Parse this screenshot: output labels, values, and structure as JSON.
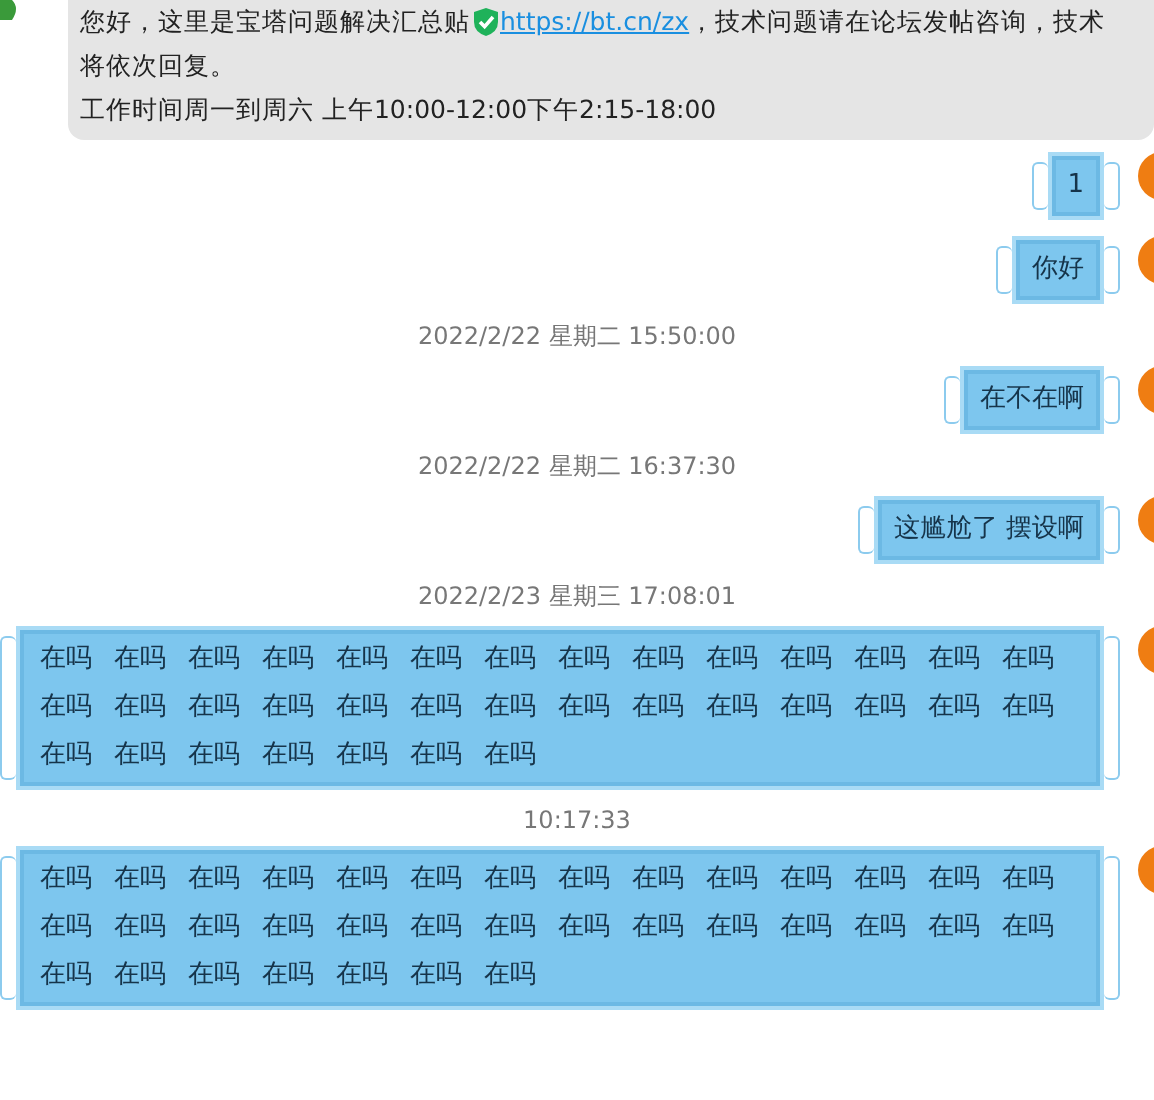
{
  "messages": [
    {
      "kind": "notice",
      "lines": [
        "您好，这里是宝塔问题解决汇总贴",
        "，技术问题请在论坛发帖咨询，技术",
        "将依次回复。",
        "工作时间周一到周六 上午10:00-12:00下午2:15-18:00"
      ],
      "link": "https://bt.cn/zx"
    },
    {
      "kind": "bubble",
      "text": "1"
    },
    {
      "kind": "bubble",
      "text": "你好"
    },
    {
      "kind": "time",
      "text": "2022/2/22 星期二 15:50:00"
    },
    {
      "kind": "bubble",
      "text": "在不在啊"
    },
    {
      "kind": "time",
      "text": "2022/2/22 星期二 16:37:30"
    },
    {
      "kind": "bubble",
      "text": "这尴尬了 摆设啊"
    },
    {
      "kind": "time",
      "text": "2022/2/23 星期三 17:08:01"
    },
    {
      "kind": "repeated",
      "words": [
        "在吗",
        "在吗",
        "在吗",
        "在吗",
        "在吗",
        "在吗",
        "在吗",
        "在吗",
        "在吗",
        "在吗",
        "在吗",
        "在吗",
        "在吗",
        "在吗",
        "在吗",
        "在吗",
        "在吗",
        "在吗",
        "在吗",
        "在吗",
        "在吗",
        "在吗",
        "在吗",
        "在吗",
        "在吗",
        "在吗",
        "在吗",
        "在吗",
        "在吗",
        "在吗",
        "在吗",
        "在吗",
        "在吗",
        "在吗",
        "在吗"
      ]
    },
    {
      "kind": "time",
      "text": "10:17:33"
    },
    {
      "kind": "repeated",
      "words": [
        "在吗",
        "在吗",
        "在吗",
        "在吗",
        "在吗",
        "在吗",
        "在吗",
        "在吗",
        "在吗",
        "在吗",
        "在吗",
        "在吗",
        "在吗",
        "在吗",
        "在吗",
        "在吗",
        "在吗",
        "在吗",
        "在吗",
        "在吗",
        "在吗",
        "在吗",
        "在吗",
        "在吗",
        "在吗",
        "在吗",
        "在吗",
        "在吗",
        "在吗",
        "在吗",
        "在吗",
        "在吗",
        "在吗",
        "在吗",
        "在吗"
      ]
    }
  ]
}
